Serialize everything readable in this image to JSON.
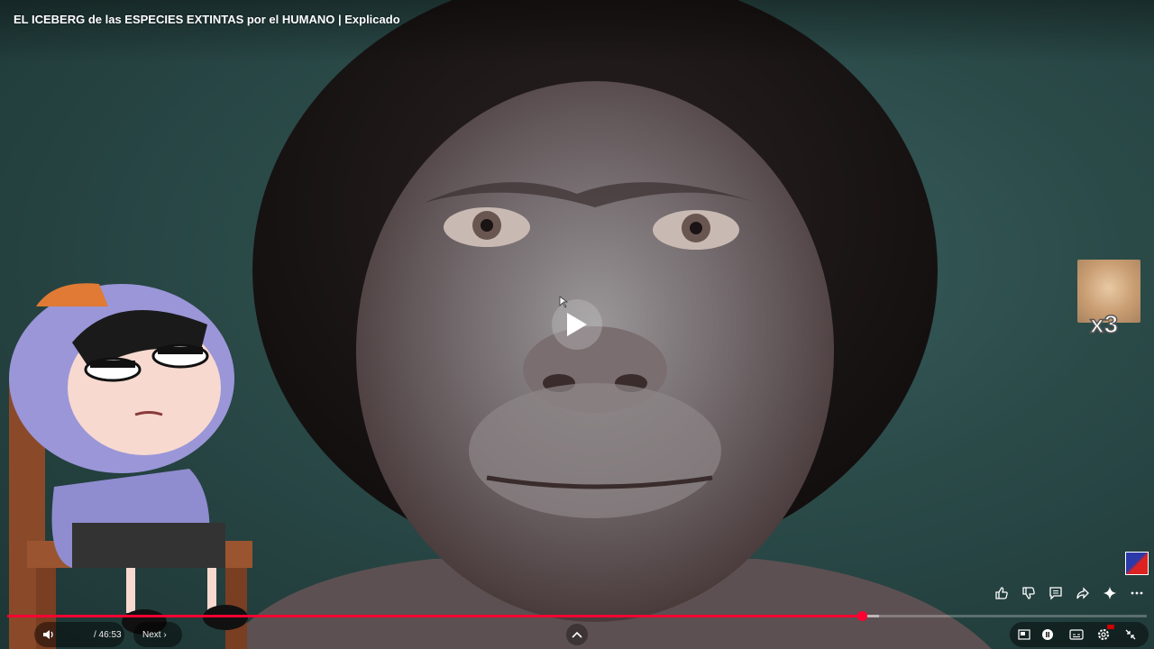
{
  "video": {
    "title": "EL ICEBERG de las ESPECIES EXTINTAS por el HUMANO | Explicado",
    "progress_fraction": 0.75,
    "buffer_fraction": 0.765
  },
  "controls": {
    "time": "/ 46:53",
    "chapter": "Next ›"
  },
  "overlay": {
    "cat_count": "x3"
  },
  "icons": {
    "play": "play-icon",
    "like": "thumb-up-icon",
    "dislike": "thumb-down-icon",
    "comments": "comment-icon",
    "share": "share-icon",
    "ask": "sparkle-icon",
    "more": "more-icon",
    "volume": "volume-icon",
    "miniplayer": "miniplayer-icon",
    "autoplay": "autoplay-icon",
    "captions": "captions-icon",
    "settings": "settings-icon",
    "exit_fullscreen": "exit-fullscreen-icon"
  },
  "colors": {
    "progress": "#ff0033",
    "background": "#2a4a48"
  }
}
